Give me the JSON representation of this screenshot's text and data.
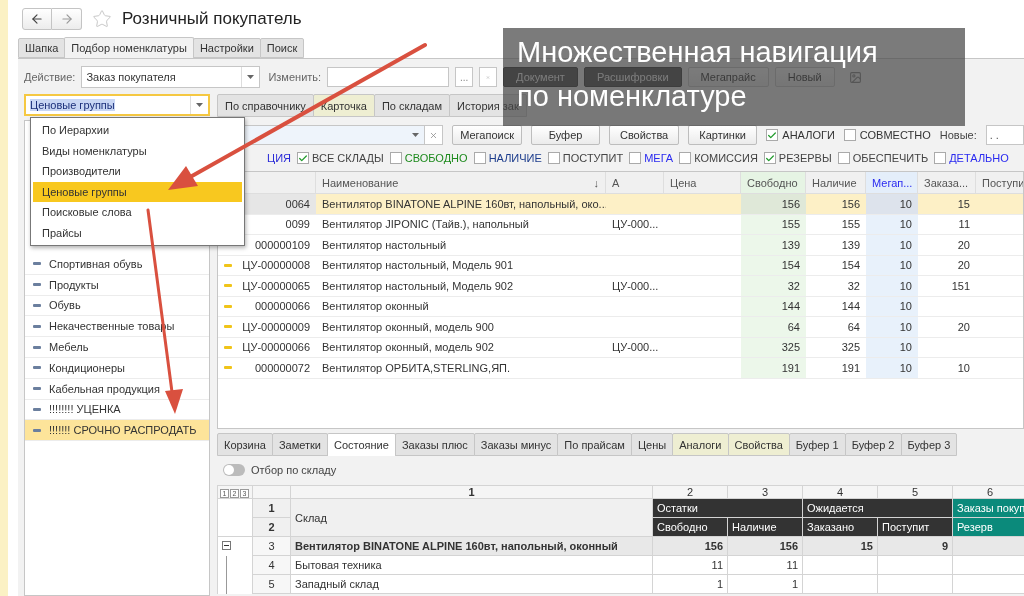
{
  "window": {
    "title": "Розничный покупатель",
    "favorite": false
  },
  "tabs": [
    {
      "label": "Шапка",
      "selected": false
    },
    {
      "label": "Подбор номенклатуры",
      "selected": true
    },
    {
      "label": "Настройки",
      "selected": false
    },
    {
      "label": "Поиск",
      "selected": false
    }
  ],
  "action": {
    "label": "Действие:",
    "value": "Заказ покупателя"
  },
  "change": {
    "label": "Изменить:",
    "more": "..."
  },
  "action_buttons": [
    {
      "label": "Документ",
      "kind": "dark"
    },
    {
      "label": "Расшифровки",
      "kind": "dark"
    },
    {
      "label": "Мегапрайс",
      "kind": "light"
    },
    {
      "label": "Новый",
      "kind": "light"
    }
  ],
  "caption": [
    "Множественная навигация",
    "по номенклатуре"
  ],
  "navigation": {
    "value": "Ценовые группы",
    "options": [
      {
        "label": "По Иерархии",
        "selected": false
      },
      {
        "label": "Виды номенклатуры",
        "selected": false
      },
      {
        "label": "Производители",
        "selected": false
      },
      {
        "label": "Ценовые группы",
        "selected": true
      },
      {
        "label": "Поисковые слова",
        "selected": false
      },
      {
        "label": "Прайсы",
        "selected": false
      }
    ]
  },
  "groups": [
    {
      "label": "Спортивная обувь",
      "selected": false
    },
    {
      "label": "Продукты",
      "selected": false
    },
    {
      "label": "Обувь",
      "selected": false
    },
    {
      "label": "Некачественные товары",
      "selected": false
    },
    {
      "label": "Мебель",
      "selected": false
    },
    {
      "label": "Кондиционеры",
      "selected": false
    },
    {
      "label": "Кабельная продукция",
      "selected": false
    },
    {
      "label": "!!!!!!!! УЦЕНКА",
      "selected": false
    },
    {
      "label": "!!!!!!! СРОЧНО РАСПРОДАТЬ",
      "selected": true
    }
  ],
  "view_tabs": [
    {
      "label": "По справочнику",
      "selected": false,
      "tinted": false
    },
    {
      "label": "Карточка",
      "selected": false,
      "tinted": true
    },
    {
      "label": "По складам",
      "selected": false,
      "tinted": false
    },
    {
      "label": "История зак",
      "selected": false,
      "tinted": false
    }
  ],
  "search_buttons": [
    "Мегапоиск",
    "Буфер",
    "Свойства",
    "Картинки"
  ],
  "search_checks": [
    {
      "label": "АНАЛОГИ",
      "checked": true
    },
    {
      "label": "СОВМЕСТНО",
      "checked": false
    }
  ],
  "new_filter": {
    "label": "Новые:",
    "value": ". ."
  },
  "filters": [
    {
      "kind": "text",
      "label": "ЦИЯ",
      "color": "#2a2ad8"
    },
    {
      "kind": "check",
      "label": "ВСЕ СКЛАДЫ",
      "checked": true,
      "color": "#444444"
    },
    {
      "kind": "check",
      "label": "СВОБОДНО",
      "checked": false,
      "color": "#1d8a1d"
    },
    {
      "kind": "check",
      "label": "НАЛИЧИЕ",
      "checked": false,
      "color": "#1c3c8c"
    },
    {
      "kind": "check",
      "label": "ПОСТУПИТ",
      "checked": false,
      "color": "#444444"
    },
    {
      "kind": "check",
      "label": "МЕГА",
      "checked": false,
      "color": "#2a2af0"
    },
    {
      "kind": "check",
      "label": "КОМИССИЯ",
      "checked": false,
      "color": "#444444"
    },
    {
      "kind": "check",
      "label": "РЕЗЕРВЫ",
      "checked": true,
      "color": "#444444"
    },
    {
      "kind": "check",
      "label": "ОБЕСПЕЧИТЬ",
      "checked": false,
      "color": "#444444"
    },
    {
      "kind": "check",
      "label": "ДЕТАЛЬНО",
      "checked": false,
      "color": "#2a2af0"
    }
  ],
  "table": {
    "columns": [
      {
        "label": "Наименование",
        "kind": "text",
        "sort": "↓"
      },
      {
        "label": "А",
        "kind": "text"
      },
      {
        "label": "Цена",
        "kind": "number"
      },
      {
        "label": "Свободно",
        "kind": "free"
      },
      {
        "label": "Наличие",
        "kind": "number"
      },
      {
        "label": "Мегап...",
        "kind": "mega"
      },
      {
        "label": "Заказа...",
        "kind": "number"
      },
      {
        "label": "Поступи",
        "kind": "number"
      }
    ],
    "rows": [
      {
        "code": "0064",
        "selected": true,
        "cells": [
          "Вентилятор BINATONE ALPINE 160вт, напольный, око...",
          "",
          "",
          "156",
          "156",
          "10",
          "15",
          ""
        ]
      },
      {
        "code": "0099",
        "selected": false,
        "cells": [
          "Вентилятор JIPONIC (Тайв.), напольный",
          "ЦУ-000...",
          "",
          "155",
          "155",
          "10",
          "11",
          ""
        ]
      },
      {
        "code": "000000109",
        "selected": false,
        "cells": [
          "Вентилятор настольный",
          "",
          "",
          "139",
          "139",
          "10",
          "20",
          ""
        ]
      },
      {
        "code": "ЦУ-00000008",
        "selected": false,
        "cells": [
          "Вентилятор настольный, Модель 901",
          "",
          "",
          "154",
          "154",
          "10",
          "20",
          ""
        ]
      },
      {
        "code": "ЦУ-00000065",
        "selected": false,
        "cells": [
          "Вентилятор настольный, Модель 902",
          "ЦУ-000...",
          "",
          "32",
          "32",
          "10",
          "151",
          ""
        ]
      },
      {
        "code": "000000066",
        "selected": false,
        "cells": [
          "Вентилятор оконный",
          "",
          "",
          "144",
          "144",
          "10",
          "",
          ""
        ]
      },
      {
        "code": "ЦУ-00000009",
        "selected": false,
        "cells": [
          "Вентилятор оконный, модель 900",
          "",
          "",
          "64",
          "64",
          "10",
          "20",
          ""
        ]
      },
      {
        "code": "ЦУ-00000066",
        "selected": false,
        "cells": [
          "Вентилятор оконный, модель 902",
          "ЦУ-000...",
          "",
          "325",
          "325",
          "10",
          "",
          ""
        ]
      },
      {
        "code": "000000072",
        "selected": false,
        "cells": [
          "Вентилятор ОРБИТА,STERLING,ЯП.",
          "",
          "",
          "191",
          "191",
          "10",
          "10",
          ""
        ]
      }
    ]
  },
  "detail_tabs": [
    {
      "label": "Корзина",
      "selected": false,
      "tinted": false
    },
    {
      "label": "Заметки",
      "selected": false,
      "tinted": false
    },
    {
      "label": "Состояние",
      "selected": true,
      "tinted": false
    },
    {
      "label": "Заказы плюс",
      "selected": false,
      "tinted": false
    },
    {
      "label": "Заказы минус",
      "selected": false,
      "tinted": false
    },
    {
      "label": "По прайсам",
      "selected": false,
      "tinted": false
    },
    {
      "label": "Цены",
      "selected": false,
      "tinted": false
    },
    {
      "label": "Аналоги",
      "selected": false,
      "tinted": true
    },
    {
      "label": "Свойства",
      "selected": false,
      "tinted": true
    },
    {
      "label": "Буфер 1",
      "selected": false,
      "tinted": false
    },
    {
      "label": "Буфер 2",
      "selected": false,
      "tinted": false
    },
    {
      "label": "Буфер 3",
      "selected": false,
      "tinted": false
    }
  ],
  "toggle": {
    "label": "Отбор по складу",
    "on": false
  },
  "sheet": {
    "levels": [
      "1",
      "2",
      "3"
    ],
    "column_numbers": [
      "1",
      "2",
      "3",
      "4",
      "5",
      "6"
    ],
    "header_numbers": [
      "1",
      "2"
    ],
    "first_header": "Склад",
    "groups": [
      {
        "label": "Остатки",
        "color": "#333333",
        "columns": [
          "Свободно",
          "Наличие"
        ]
      },
      {
        "label": "Ожидается",
        "color": "#333333",
        "columns": [
          "Заказано",
          "Поступит"
        ]
      },
      {
        "label": "Заказы покуп",
        "color": "#0b8a7b",
        "columns": [
          "Резерв"
        ]
      }
    ],
    "rows": [
      {
        "number": "3",
        "kind": "group",
        "expanded": true,
        "label": "Вентилятор BINATONE ALPINE 160вт, напольный, оконный",
        "values": [
          "156",
          "156",
          "15",
          "9"
        ]
      },
      {
        "number": "4",
        "kind": "item",
        "label": "Бытовая техника",
        "values": [
          "11",
          "11"
        ]
      },
      {
        "number": "5",
        "kind": "item",
        "label": "Западный склад",
        "values": [
          "1",
          "1"
        ]
      }
    ]
  }
}
